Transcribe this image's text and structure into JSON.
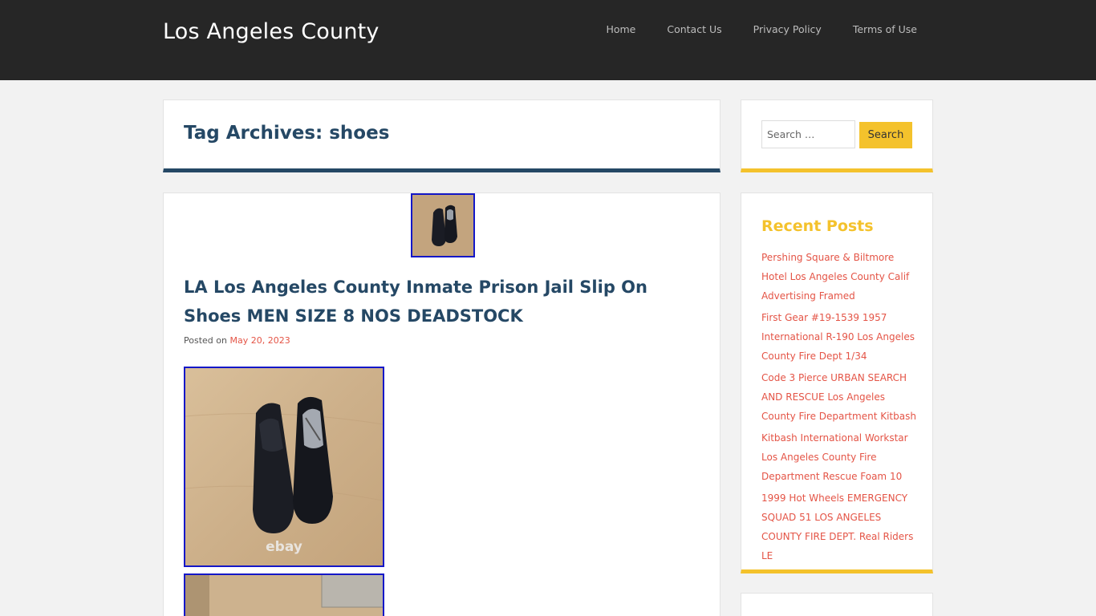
{
  "site": {
    "title": "Los Angeles County"
  },
  "nav": [
    {
      "label": "Home"
    },
    {
      "label": "Contact Us"
    },
    {
      "label": "Privacy Policy"
    },
    {
      "label": "Terms of Use"
    }
  ],
  "archive": {
    "title": "Tag Archives: shoes"
  },
  "post": {
    "title": "LA Los Angeles County Inmate Prison Jail Slip On Shoes MEN SIZE 8 NOS DEADSTOCK",
    "posted_on_label": "Posted on",
    "date": "May 20, 2023",
    "image_watermark": "ebay"
  },
  "search": {
    "placeholder": "Search …",
    "button_label": "Search"
  },
  "recent_posts": {
    "title": "Recent Posts",
    "items": [
      {
        "label": "Pershing Square & Biltmore Hotel Los Angeles County Calif Advertising Framed"
      },
      {
        "label": "First Gear #19-1539 1957 International R-190 Los Angeles County Fire Dept 1/34"
      },
      {
        "label": "Code 3 Pierce URBAN SEARCH AND RESCUE Los Angeles County Fire Department Kitbash"
      },
      {
        "label": "Kitbash International Workstar Los Angeles County Fire Department Rescue Foam 10"
      },
      {
        "label": "1999 Hot Wheels EMERGENCY SQUAD 51 LOS ANGELES COUNTY FIRE DEPT. Real Riders LE"
      }
    ]
  },
  "colors": {
    "header_bg": "#262626",
    "title_blue": "#254865",
    "accent_yellow": "#f4c22c",
    "link_red": "#e45446",
    "image_border": "#1417c8"
  }
}
